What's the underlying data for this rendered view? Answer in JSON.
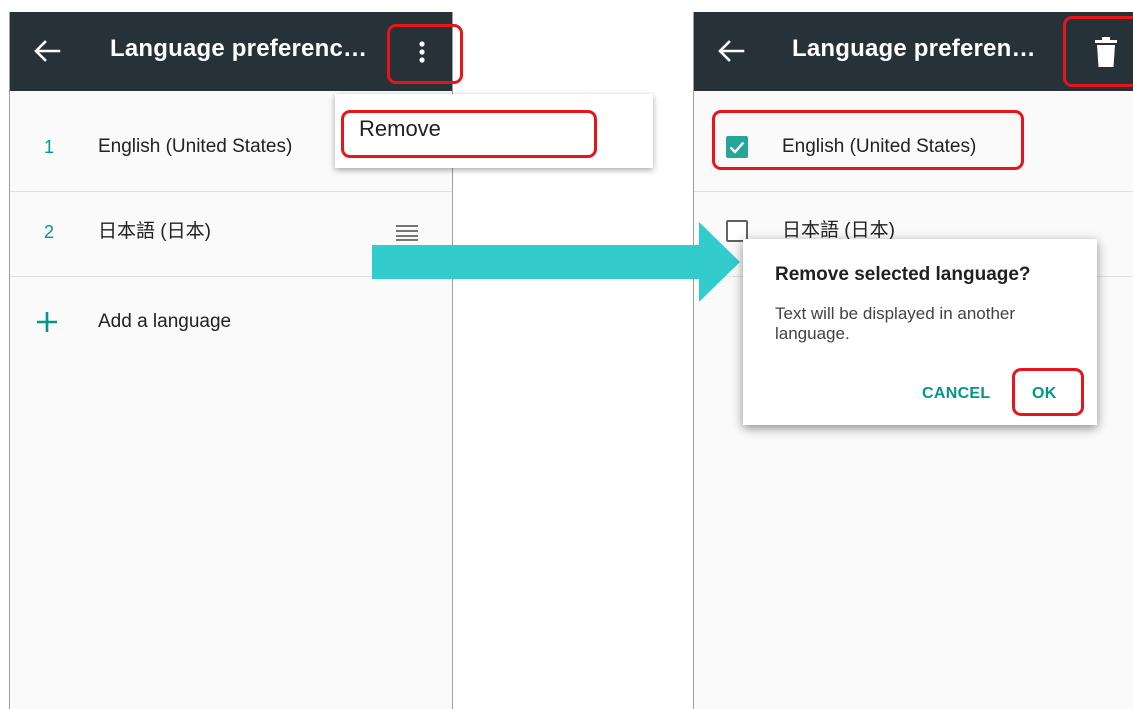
{
  "left": {
    "title": "Language preferenc…",
    "languages": [
      {
        "num": "1",
        "label": "English (United States)"
      },
      {
        "num": "2",
        "label": "日本語 (日本)"
      }
    ],
    "add_label": "Add a language",
    "menu_item": "Remove"
  },
  "right": {
    "title": "Language preferen…",
    "languages": [
      {
        "label": "English (United States)",
        "checked": true
      },
      {
        "label": "日本語 (日本)",
        "checked": false
      }
    ],
    "dialog": {
      "title": "Remove selected language?",
      "message": "Text will be displayed in another language.",
      "cancel": "CANCEL",
      "ok": "OK"
    }
  },
  "colors": {
    "toolbar": "#263238",
    "accent": "#009688",
    "highlight": "#e8141c",
    "arrow": "#33cccc"
  }
}
